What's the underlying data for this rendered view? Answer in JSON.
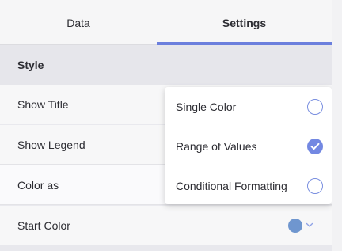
{
  "tabs": [
    {
      "label": "Data",
      "active": false
    },
    {
      "label": "Settings",
      "active": true
    }
  ],
  "accent_color": "#6b7fdd",
  "section": {
    "title": "Style"
  },
  "rows": [
    {
      "label": "Show Title"
    },
    {
      "label": "Show Legend"
    },
    {
      "label": "Color as"
    },
    {
      "label": "Start Color",
      "value_color": "#6f96cf",
      "value_icon": "chevron-down-icon"
    }
  ],
  "color_as_options": [
    {
      "label": "Single Color",
      "selected": false
    },
    {
      "label": "Range of Values",
      "selected": true
    },
    {
      "label": "Conditional Formatting",
      "selected": false
    }
  ]
}
